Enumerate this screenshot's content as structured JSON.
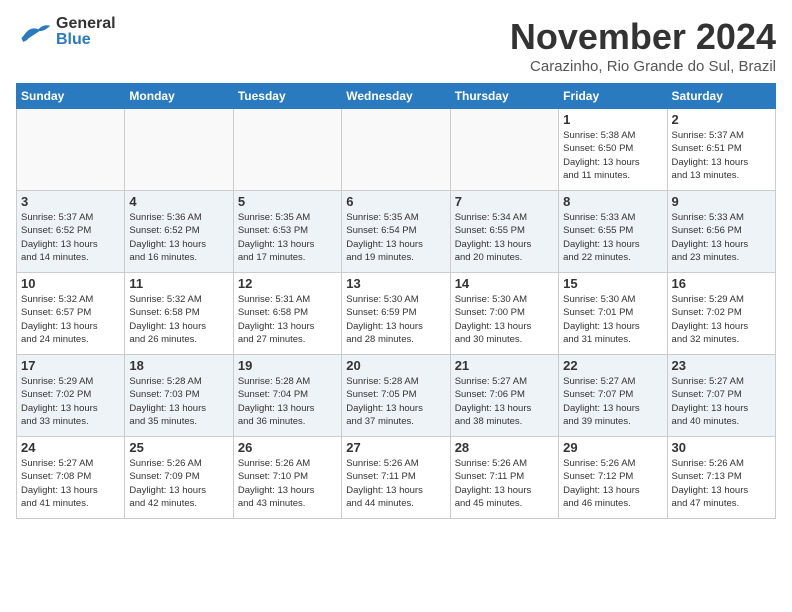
{
  "header": {
    "logo_general": "General",
    "logo_blue": "Blue",
    "month_title": "November 2024",
    "location": "Carazinho, Rio Grande do Sul, Brazil"
  },
  "days_of_week": [
    "Sunday",
    "Monday",
    "Tuesday",
    "Wednesday",
    "Thursday",
    "Friday",
    "Saturday"
  ],
  "weeks": [
    [
      {
        "day": "",
        "info": ""
      },
      {
        "day": "",
        "info": ""
      },
      {
        "day": "",
        "info": ""
      },
      {
        "day": "",
        "info": ""
      },
      {
        "day": "",
        "info": ""
      },
      {
        "day": "1",
        "info": "Sunrise: 5:38 AM\nSunset: 6:50 PM\nDaylight: 13 hours\nand 11 minutes."
      },
      {
        "day": "2",
        "info": "Sunrise: 5:37 AM\nSunset: 6:51 PM\nDaylight: 13 hours\nand 13 minutes."
      }
    ],
    [
      {
        "day": "3",
        "info": "Sunrise: 5:37 AM\nSunset: 6:52 PM\nDaylight: 13 hours\nand 14 minutes."
      },
      {
        "day": "4",
        "info": "Sunrise: 5:36 AM\nSunset: 6:52 PM\nDaylight: 13 hours\nand 16 minutes."
      },
      {
        "day": "5",
        "info": "Sunrise: 5:35 AM\nSunset: 6:53 PM\nDaylight: 13 hours\nand 17 minutes."
      },
      {
        "day": "6",
        "info": "Sunrise: 5:35 AM\nSunset: 6:54 PM\nDaylight: 13 hours\nand 19 minutes."
      },
      {
        "day": "7",
        "info": "Sunrise: 5:34 AM\nSunset: 6:55 PM\nDaylight: 13 hours\nand 20 minutes."
      },
      {
        "day": "8",
        "info": "Sunrise: 5:33 AM\nSunset: 6:55 PM\nDaylight: 13 hours\nand 22 minutes."
      },
      {
        "day": "9",
        "info": "Sunrise: 5:33 AM\nSunset: 6:56 PM\nDaylight: 13 hours\nand 23 minutes."
      }
    ],
    [
      {
        "day": "10",
        "info": "Sunrise: 5:32 AM\nSunset: 6:57 PM\nDaylight: 13 hours\nand 24 minutes."
      },
      {
        "day": "11",
        "info": "Sunrise: 5:32 AM\nSunset: 6:58 PM\nDaylight: 13 hours\nand 26 minutes."
      },
      {
        "day": "12",
        "info": "Sunrise: 5:31 AM\nSunset: 6:58 PM\nDaylight: 13 hours\nand 27 minutes."
      },
      {
        "day": "13",
        "info": "Sunrise: 5:30 AM\nSunset: 6:59 PM\nDaylight: 13 hours\nand 28 minutes."
      },
      {
        "day": "14",
        "info": "Sunrise: 5:30 AM\nSunset: 7:00 PM\nDaylight: 13 hours\nand 30 minutes."
      },
      {
        "day": "15",
        "info": "Sunrise: 5:30 AM\nSunset: 7:01 PM\nDaylight: 13 hours\nand 31 minutes."
      },
      {
        "day": "16",
        "info": "Sunrise: 5:29 AM\nSunset: 7:02 PM\nDaylight: 13 hours\nand 32 minutes."
      }
    ],
    [
      {
        "day": "17",
        "info": "Sunrise: 5:29 AM\nSunset: 7:02 PM\nDaylight: 13 hours\nand 33 minutes."
      },
      {
        "day": "18",
        "info": "Sunrise: 5:28 AM\nSunset: 7:03 PM\nDaylight: 13 hours\nand 35 minutes."
      },
      {
        "day": "19",
        "info": "Sunrise: 5:28 AM\nSunset: 7:04 PM\nDaylight: 13 hours\nand 36 minutes."
      },
      {
        "day": "20",
        "info": "Sunrise: 5:28 AM\nSunset: 7:05 PM\nDaylight: 13 hours\nand 37 minutes."
      },
      {
        "day": "21",
        "info": "Sunrise: 5:27 AM\nSunset: 7:06 PM\nDaylight: 13 hours\nand 38 minutes."
      },
      {
        "day": "22",
        "info": "Sunrise: 5:27 AM\nSunset: 7:07 PM\nDaylight: 13 hours\nand 39 minutes."
      },
      {
        "day": "23",
        "info": "Sunrise: 5:27 AM\nSunset: 7:07 PM\nDaylight: 13 hours\nand 40 minutes."
      }
    ],
    [
      {
        "day": "24",
        "info": "Sunrise: 5:27 AM\nSunset: 7:08 PM\nDaylight: 13 hours\nand 41 minutes."
      },
      {
        "day": "25",
        "info": "Sunrise: 5:26 AM\nSunset: 7:09 PM\nDaylight: 13 hours\nand 42 minutes."
      },
      {
        "day": "26",
        "info": "Sunrise: 5:26 AM\nSunset: 7:10 PM\nDaylight: 13 hours\nand 43 minutes."
      },
      {
        "day": "27",
        "info": "Sunrise: 5:26 AM\nSunset: 7:11 PM\nDaylight: 13 hours\nand 44 minutes."
      },
      {
        "day": "28",
        "info": "Sunrise: 5:26 AM\nSunset: 7:11 PM\nDaylight: 13 hours\nand 45 minutes."
      },
      {
        "day": "29",
        "info": "Sunrise: 5:26 AM\nSunset: 7:12 PM\nDaylight: 13 hours\nand 46 minutes."
      },
      {
        "day": "30",
        "info": "Sunrise: 5:26 AM\nSunset: 7:13 PM\nDaylight: 13 hours\nand 47 minutes."
      }
    ]
  ]
}
